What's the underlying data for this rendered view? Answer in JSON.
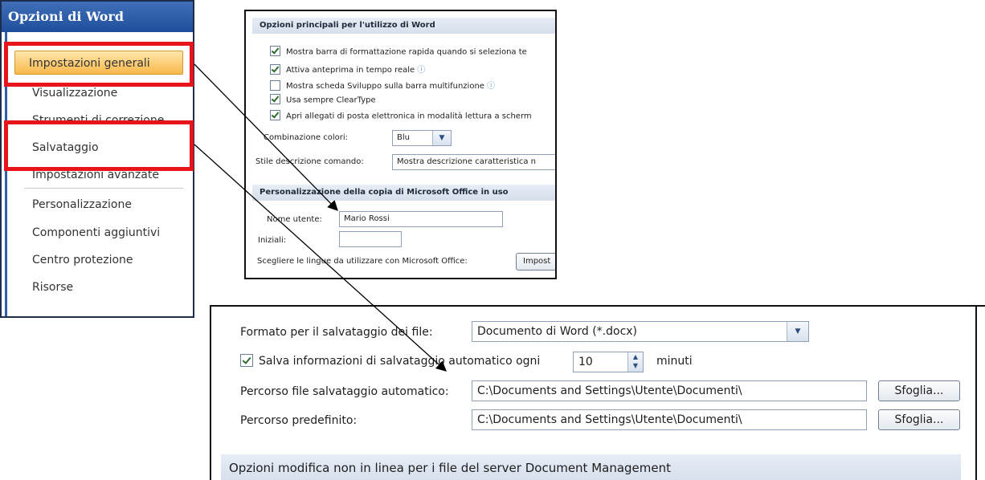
{
  "nav": {
    "title": "Opzioni di Word",
    "items": [
      {
        "label": "Impostazioni generali",
        "active": true
      },
      {
        "label": "Visualizzazione"
      },
      {
        "label": "Strumenti di correzione"
      },
      {
        "label": "Salvataggio"
      },
      {
        "label": "Impostazioni avanzate"
      },
      {
        "label": "Personalizzazione"
      },
      {
        "label": "Componenti aggiuntivi"
      },
      {
        "label": "Centro protezione"
      },
      {
        "label": "Risorse"
      }
    ]
  },
  "general": {
    "section1_title": "Opzioni principali per l'utilizzo di Word",
    "checks": [
      {
        "label": "Mostra barra di formattazione rapida quando si seleziona te",
        "checked": true,
        "info": false
      },
      {
        "label": "Attiva anteprima in tempo reale",
        "checked": true,
        "info": true
      },
      {
        "label": "Mostra scheda Sviluppo sulla barra multifunzione",
        "checked": false,
        "info": true
      },
      {
        "label": "Usa sempre ClearType",
        "checked": true,
        "info": false
      },
      {
        "label": "Apri allegati di posta elettronica in modalità lettura a scherm",
        "checked": true,
        "info": false
      }
    ],
    "color_scheme_label": "Combinazione colori:",
    "color_scheme_value": "Blu",
    "tooltip_style_label": "Stile descrizione comando:",
    "tooltip_style_value": "Mostra descrizione caratteristica n",
    "section2_title": "Personalizzazione della copia di Microsoft Office in uso",
    "username_label": "Nome utente:",
    "username_value": "Mario Rossi",
    "initials_label": "Iniziali:",
    "initials_value": "",
    "language_label": "Scegliere le lingue da utilizzare con Microsoft Office:",
    "language_button": "Impost"
  },
  "save": {
    "format_label": "Formato per il salvataggio dei file:",
    "format_value": "Documento di Word (*.docx)",
    "autosave_label": "Salva informazioni di salvataggio automatico ogni",
    "autosave_checked": true,
    "autosave_minutes": "10",
    "minutes_label": "minuti",
    "autosave_path_label": "Percorso file salvataggio automatico:",
    "autosave_path_value": "C:\\Documents and Settings\\Utente\\Documenti\\",
    "default_path_label": "Percorso predefinito:",
    "default_path_value": "C:\\Documents and Settings\\Utente\\Documenti\\",
    "browse_label": "Sfoglia...",
    "section_title": "Opzioni modifica non in linea per i file del server Document Management"
  },
  "colors": {
    "highlight": "#e8141b",
    "title_bar": "#2c5aa3",
    "active_item": "#f9b84b",
    "section_header": "#dbe3ee"
  }
}
